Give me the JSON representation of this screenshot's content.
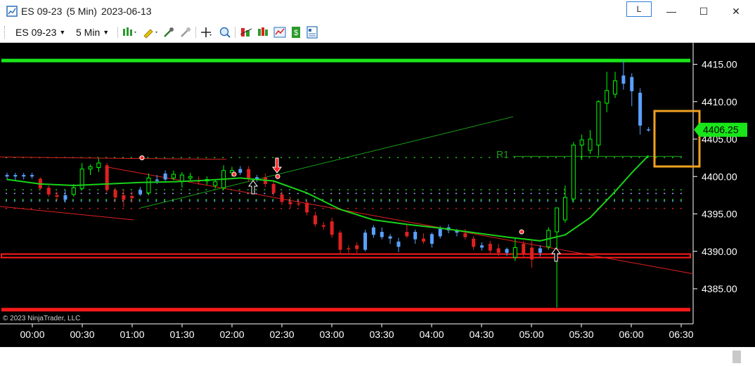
{
  "window": {
    "title_symbol": "ES 09-23",
    "title_interval": "(5 Min)",
    "title_date": "2023-06-13",
    "link_label": "L",
    "minimize": "—",
    "maximize": "☐",
    "close": "✕"
  },
  "toolbar": {
    "instrument": "ES 09-23",
    "interval": "5 Min"
  },
  "chart": {
    "copyright": "© 2023 NinjaTrader, LLC",
    "last_price_label": "4406.25",
    "pivot_label": "R1",
    "price_ticks": [
      "4415.00",
      "4410.00",
      "4405.00",
      "4400.00",
      "4395.00",
      "4390.00",
      "4385.00"
    ],
    "time_ticks": [
      "00:00",
      "00:30",
      "01:00",
      "01:30",
      "02:00",
      "02:30",
      "03:00",
      "03:30",
      "04:00",
      "04:30",
      "05:00",
      "05:30",
      "06:00",
      "06:30"
    ],
    "colors": {
      "background": "#000000",
      "up": "#5aa0ff",
      "down": "#e02020",
      "hollow": "#00ff00",
      "sma": "#19d219",
      "resistance": "#19e619",
      "support": "#ff1a1a",
      "highlight": "#f0a020",
      "price_marker": "#19e619"
    }
  },
  "chart_data": {
    "type": "candlestick",
    "ylim": [
      4381.5,
      4418.5
    ],
    "x_unit": "5-minute bars starting 00:00",
    "bars": [
      {
        "x": 0,
        "o": 4400.0,
        "h": 4400.5,
        "l": 4399.5,
        "c": 4400.2,
        "color": "blue"
      },
      {
        "x": 1,
        "o": 4400.0,
        "h": 4400.5,
        "l": 4399.5,
        "c": 4400.2,
        "color": "blue"
      },
      {
        "x": 2,
        "o": 4400.0,
        "h": 4400.5,
        "l": 4399.6,
        "c": 4400.2,
        "color": "blue"
      },
      {
        "x": 3,
        "o": 4400.0,
        "h": 4400.5,
        "l": 4399.7,
        "c": 4400.2,
        "color": "blue"
      },
      {
        "x": 4,
        "o": 4399.7,
        "h": 4399.9,
        "l": 4398.2,
        "c": 4398.4,
        "color": "red"
      },
      {
        "x": 5,
        "o": 4398.5,
        "h": 4398.8,
        "l": 4397.3,
        "c": 4397.6,
        "color": "red"
      },
      {
        "x": 6,
        "o": 4397.5,
        "h": 4398.0,
        "l": 4396.8,
        "c": 4397.3,
        "color": "red"
      },
      {
        "x": 7,
        "o": 4396.9,
        "h": 4398.2,
        "l": 4396.5,
        "c": 4397.5,
        "color": "blue"
      },
      {
        "x": 8,
        "o": 4397.6,
        "h": 4399.0,
        "l": 4397.3,
        "c": 4398.5,
        "color": "green"
      },
      {
        "x": 9,
        "o": 4398.4,
        "h": 4401.8,
        "l": 4398.2,
        "c": 4401.0,
        "color": "green"
      },
      {
        "x": 10,
        "o": 4401.0,
        "h": 4401.6,
        "l": 4400.2,
        "c": 4401.3,
        "color": "green"
      },
      {
        "x": 11,
        "o": 4401.2,
        "h": 4402.4,
        "l": 4400.6,
        "c": 4401.8,
        "color": "green"
      },
      {
        "x": 12,
        "o": 4401.5,
        "h": 4401.8,
        "l": 4397.9,
        "c": 4398.2,
        "color": "red"
      },
      {
        "x": 13,
        "o": 4398.2,
        "h": 4398.5,
        "l": 4396.6,
        "c": 4397.2,
        "color": "red"
      },
      {
        "x": 14,
        "o": 4397.5,
        "h": 4398.3,
        "l": 4395.9,
        "c": 4396.9,
        "color": "red"
      },
      {
        "x": 15,
        "o": 4397.1,
        "h": 4398.0,
        "l": 4396.5,
        "c": 4397.4,
        "color": "red"
      },
      {
        "x": 16,
        "o": 4397.6,
        "h": 4398.6,
        "l": 4397.4,
        "c": 4398.2,
        "color": "blue"
      },
      {
        "x": 17,
        "o": 4397.8,
        "h": 4400.4,
        "l": 4397.5,
        "c": 4399.8,
        "color": "green"
      },
      {
        "x": 18,
        "o": 4399.4,
        "h": 4400.2,
        "l": 4399.0,
        "c": 4399.6,
        "color": "blue"
      },
      {
        "x": 19,
        "o": 4399.6,
        "h": 4400.8,
        "l": 4399.4,
        "c": 4400.4,
        "color": "blue"
      },
      {
        "x": 20,
        "o": 4399.8,
        "h": 4400.8,
        "l": 4399.5,
        "c": 4400.3,
        "color": "green"
      },
      {
        "x": 21,
        "o": 4399.3,
        "h": 4400.6,
        "l": 4398.5,
        "c": 4400.2,
        "color": "green"
      },
      {
        "x": 22,
        "o": 4399.8,
        "h": 4400.5,
        "l": 4399.4,
        "c": 4400.0,
        "color": "green"
      },
      {
        "x": 23,
        "o": 4399.5,
        "h": 4400.0,
        "l": 4398.9,
        "c": 4399.3,
        "color": "red"
      },
      {
        "x": 24,
        "o": 4399.4,
        "h": 4400.0,
        "l": 4398.9,
        "c": 4399.6,
        "color": "green"
      },
      {
        "x": 25,
        "o": 4398.8,
        "h": 4399.5,
        "l": 4398.4,
        "c": 4399.3,
        "color": "green"
      },
      {
        "x": 26,
        "o": 4398.5,
        "h": 4401.5,
        "l": 4398.2,
        "c": 4400.8,
        "color": "green"
      },
      {
        "x": 27,
        "o": 4400.8,
        "h": 4401.3,
        "l": 4400.0,
        "c": 4400.5,
        "color": "green"
      },
      {
        "x": 28,
        "o": 4400.5,
        "h": 4401.4,
        "l": 4400.2,
        "c": 4401.0,
        "color": "blue"
      },
      {
        "x": 29,
        "o": 4401.0,
        "h": 4401.4,
        "l": 4399.3,
        "c": 4399.7,
        "color": "red"
      },
      {
        "x": 30,
        "o": 4399.6,
        "h": 4400.2,
        "l": 4399.3,
        "c": 4399.9,
        "color": "blue"
      },
      {
        "x": 31,
        "o": 4399.9,
        "h": 4400.4,
        "l": 4398.6,
        "c": 4399.0,
        "color": "red"
      },
      {
        "x": 32,
        "o": 4399.0,
        "h": 4399.5,
        "l": 4397.4,
        "c": 4397.8,
        "color": "red"
      },
      {
        "x": 33,
        "o": 4397.6,
        "h": 4398.0,
        "l": 4396.2,
        "c": 4396.6,
        "color": "red"
      },
      {
        "x": 34,
        "o": 4396.6,
        "h": 4397.3,
        "l": 4395.8,
        "c": 4396.3,
        "color": "red"
      },
      {
        "x": 35,
        "o": 4396.4,
        "h": 4396.9,
        "l": 4396.0,
        "c": 4396.3,
        "color": "red"
      },
      {
        "x": 36,
        "o": 4396.5,
        "h": 4396.8,
        "l": 4394.8,
        "c": 4395.2,
        "color": "red"
      },
      {
        "x": 37,
        "o": 4394.8,
        "h": 4395.3,
        "l": 4393.3,
        "c": 4393.6,
        "color": "red"
      },
      {
        "x": 38,
        "o": 4393.5,
        "h": 4393.9,
        "l": 4392.9,
        "c": 4393.3,
        "color": "red"
      },
      {
        "x": 39,
        "o": 4394.0,
        "h": 4394.5,
        "l": 4391.8,
        "c": 4392.2,
        "color": "red"
      },
      {
        "x": 40,
        "o": 4392.5,
        "h": 4392.8,
        "l": 4389.7,
        "c": 4390.2,
        "color": "red"
      },
      {
        "x": 41,
        "o": 4390.4,
        "h": 4390.8,
        "l": 4389.8,
        "c": 4390.3,
        "color": "red"
      },
      {
        "x": 42,
        "o": 4390.3,
        "h": 4391.2,
        "l": 4389.8,
        "c": 4390.8,
        "color": "red"
      },
      {
        "x": 43,
        "o": 4390.2,
        "h": 4392.9,
        "l": 4390.0,
        "c": 4392.5,
        "color": "blue"
      },
      {
        "x": 44,
        "o": 4392.2,
        "h": 4393.5,
        "l": 4391.8,
        "c": 4393.2,
        "color": "blue"
      },
      {
        "x": 45,
        "o": 4392.6,
        "h": 4393.2,
        "l": 4391.6,
        "c": 4391.9,
        "color": "blue"
      },
      {
        "x": 46,
        "o": 4391.7,
        "h": 4392.3,
        "l": 4391.0,
        "c": 4392.0,
        "color": "blue"
      },
      {
        "x": 47,
        "o": 4391.3,
        "h": 4391.8,
        "l": 4389.9,
        "c": 4390.6,
        "color": "blue"
      },
      {
        "x": 48,
        "o": 4392.6,
        "h": 4393.5,
        "l": 4391.8,
        "c": 4392.0,
        "color": "red"
      },
      {
        "x": 49,
        "o": 4391.6,
        "h": 4392.9,
        "l": 4391.0,
        "c": 4392.6,
        "color": "blue"
      },
      {
        "x": 50,
        "o": 4391.7,
        "h": 4392.4,
        "l": 4391.0,
        "c": 4391.3,
        "color": "red"
      },
      {
        "x": 51,
        "o": 4391.0,
        "h": 4392.5,
        "l": 4390.5,
        "c": 4392.3,
        "color": "blue"
      },
      {
        "x": 52,
        "o": 4392.0,
        "h": 4393.4,
        "l": 4391.7,
        "c": 4393.0,
        "color": "blue"
      },
      {
        "x": 53,
        "o": 4392.8,
        "h": 4393.6,
        "l": 4392.4,
        "c": 4393.2,
        "color": "blue"
      },
      {
        "x": 54,
        "o": 4392.5,
        "h": 4393.0,
        "l": 4392.0,
        "c": 4392.8,
        "color": "blue"
      },
      {
        "x": 55,
        "o": 4392.4,
        "h": 4393.0,
        "l": 4391.6,
        "c": 4391.9,
        "color": "red"
      },
      {
        "x": 56,
        "o": 4391.7,
        "h": 4392.0,
        "l": 4390.2,
        "c": 4390.6,
        "color": "red"
      },
      {
        "x": 57,
        "o": 4390.5,
        "h": 4391.2,
        "l": 4390.1,
        "c": 4390.8,
        "color": "blue"
      },
      {
        "x": 58,
        "o": 4391.0,
        "h": 4391.4,
        "l": 4389.7,
        "c": 4390.1,
        "color": "red"
      },
      {
        "x": 59,
        "o": 4390.4,
        "h": 4391.0,
        "l": 4389.4,
        "c": 4389.8,
        "color": "red"
      },
      {
        "x": 60,
        "o": 4389.8,
        "h": 4390.5,
        "l": 4389.4,
        "c": 4390.3,
        "color": "blue"
      },
      {
        "x": 61,
        "o": 4390.5,
        "h": 4391.8,
        "l": 4388.7,
        "c": 4389.2,
        "color": "green"
      },
      {
        "x": 62,
        "o": 4389.6,
        "h": 4391.4,
        "l": 4389.2,
        "c": 4391.0,
        "color": "red"
      },
      {
        "x": 63,
        "o": 4390.5,
        "h": 4391.4,
        "l": 4387.8,
        "c": 4388.9,
        "color": "red"
      },
      {
        "x": 64,
        "o": 4389.8,
        "h": 4390.8,
        "l": 4389.3,
        "c": 4390.4,
        "color": "blue"
      },
      {
        "x": 65,
        "o": 4390.6,
        "h": 4393.2,
        "l": 4390.2,
        "c": 4392.8,
        "color": "green"
      },
      {
        "x": 66,
        "o": 4392.6,
        "h": 4393.4,
        "l": 4382.5,
        "c": 4395.8,
        "color": "green"
      },
      {
        "x": 67,
        "o": 4394.2,
        "h": 4398.8,
        "l": 4393.8,
        "c": 4397.2,
        "color": "green"
      },
      {
        "x": 68,
        "o": 4397.0,
        "h": 4404.6,
        "l": 4396.5,
        "c": 4404.2,
        "color": "green"
      },
      {
        "x": 69,
        "o": 4404.2,
        "h": 4405.6,
        "l": 4402.2,
        "c": 4404.9,
        "color": "green"
      },
      {
        "x": 70,
        "o": 4403.5,
        "h": 4406.2,
        "l": 4403.0,
        "c": 4405.0,
        "color": "green"
      },
      {
        "x": 71,
        "o": 4404.2,
        "h": 4410.2,
        "l": 4402.8,
        "c": 4410.0,
        "color": "green"
      },
      {
        "x": 72,
        "o": 4409.8,
        "h": 4414.0,
        "l": 4408.6,
        "c": 4411.5,
        "color": "green"
      },
      {
        "x": 73,
        "o": 4411.0,
        "h": 4414.0,
        "l": 4410.5,
        "c": 4412.8,
        "color": "green"
      },
      {
        "x": 74,
        "o": 4412.4,
        "h": 4415.6,
        "l": 4411.6,
        "c": 4413.5,
        "color": "blue"
      },
      {
        "x": 75,
        "o": 4413.3,
        "h": 4413.8,
        "l": 4409.4,
        "c": 4411.4,
        "color": "blue"
      },
      {
        "x": 76,
        "o": 4411.2,
        "h": 4411.8,
        "l": 4405.6,
        "c": 4406.8,
        "color": "blue"
      },
      {
        "x": 77,
        "o": 4406.3,
        "h": 4406.6,
        "l": 4406.0,
        "c": 4406.3,
        "color": "blue"
      }
    ],
    "sma": [
      [
        0,
        4399.6
      ],
      [
        4,
        4399.0
      ],
      [
        8,
        4398.8
      ],
      [
        12,
        4399.0
      ],
      [
        16,
        4399.2
      ],
      [
        20,
        4399.3
      ],
      [
        24,
        4399.5
      ],
      [
        28,
        4399.8
      ],
      [
        32,
        4399.4
      ],
      [
        36,
        4397.8
      ],
      [
        40,
        4395.6
      ],
      [
        44,
        4394.2
      ],
      [
        48,
        4393.6
      ],
      [
        52,
        4393.1
      ],
      [
        56,
        4392.5
      ],
      [
        60,
        4391.9
      ],
      [
        64,
        4391.4
      ],
      [
        67,
        4392.2
      ],
      [
        70,
        4394.5
      ],
      [
        73,
        4398.0
      ],
      [
        75,
        4400.5
      ],
      [
        77,
        4402.8
      ]
    ],
    "levels": {
      "resistance_top": 4415.5,
      "r1": 4402.7,
      "support": 4389.4,
      "support_bottom": 4382.2
    },
    "ylabel": "",
    "xlabel": ""
  }
}
